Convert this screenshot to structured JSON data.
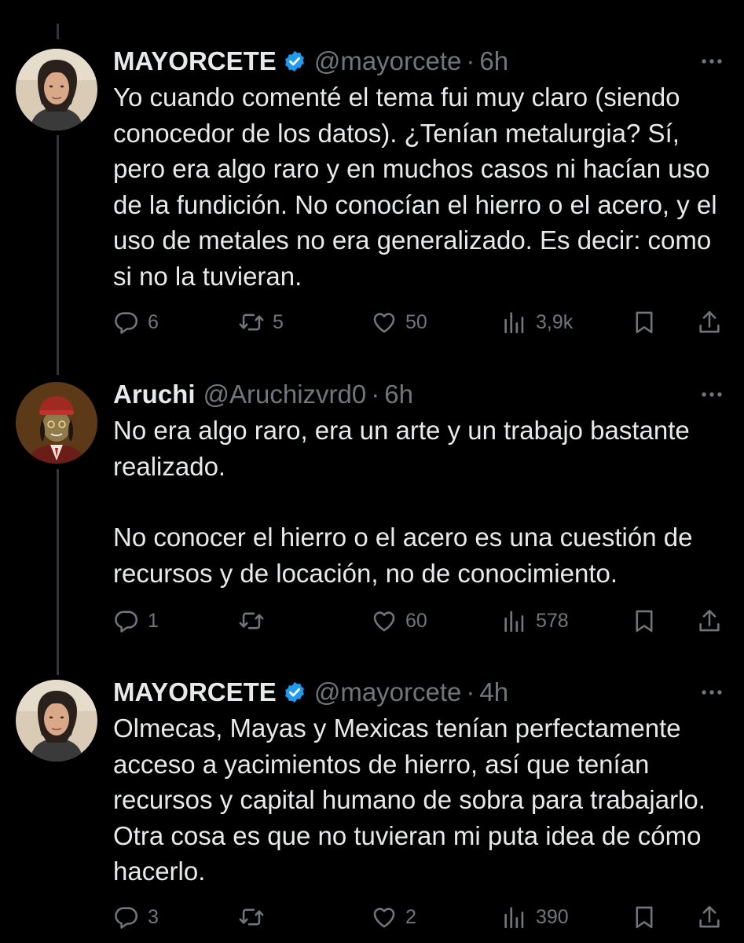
{
  "tweets": [
    {
      "name": "MAYORCETE",
      "verified": true,
      "handle": "@mayorcete",
      "separator": "·",
      "time": "6h",
      "paragraphs": [
        "Yo cuando comenté el tema fui muy claro (siendo conocedor de los datos). ¿Tenían metalurgia? Sí, pero era algo raro y en muchos casos ni hacían uso de la fundición. No conocían el hierro o el acero, y el uso de metales no era generalizado. Es decir: como si no la tuvieran."
      ],
      "replies": "6",
      "retweets": "5",
      "likes": "50",
      "views": "3,9k",
      "avatar_icon": "man-with-long-hair-avatar"
    },
    {
      "name": "Aruchi",
      "verified": false,
      "handle": "@Aruchizvrd0",
      "separator": "·",
      "time": "6h",
      "paragraphs": [
        "No era algo raro, era un arte y un trabajo bastante realizado.",
        "No conocer el hierro o el acero es una cuestión de recursos y de locación, no de conocimiento."
      ],
      "replies": "1",
      "retweets": "",
      "likes": "60",
      "views": "578",
      "avatar_icon": "cartoon-character-red-hat-avatar"
    },
    {
      "name": "MAYORCETE",
      "verified": true,
      "handle": "@mayorcete",
      "separator": "·",
      "time": "4h",
      "paragraphs": [
        "Olmecas, Mayas y Mexicas tenían perfectamente acceso a yacimientos de hierro, así que tenían recursos y capital humano de sobra para trabajarlo. Otra cosa es que no tuvieran mi puta idea de cómo hacerlo."
      ],
      "replies": "3",
      "retweets": "",
      "likes": "2",
      "views": "390",
      "avatar_icon": "man-with-long-hair-avatar"
    }
  ],
  "colors": {
    "background": "#000000",
    "text": "#e7e9ea",
    "secondary": "#71767b",
    "verified_badge": "#1d9bf0",
    "thread_line": "#333639"
  }
}
